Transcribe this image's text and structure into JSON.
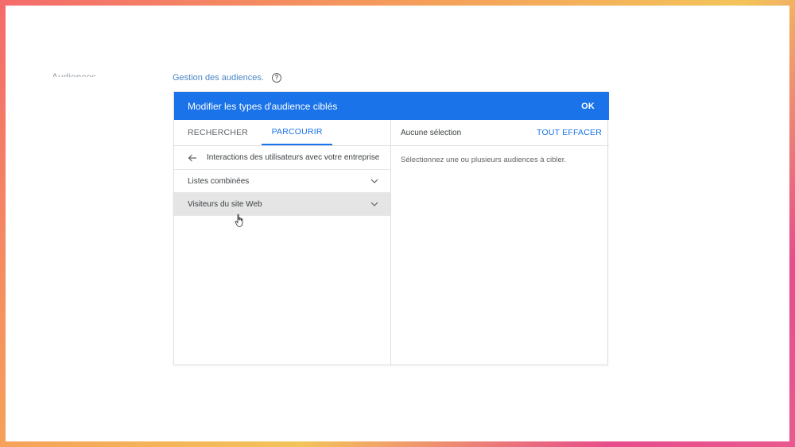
{
  "left_label": "Audiences",
  "page": {
    "link": "Gestion des audiences.",
    "help_icon": "help-circle-icon"
  },
  "dialog": {
    "title": "Modifier les types d'audience ciblés",
    "ok_label": "OK",
    "tabs": [
      {
        "label": "RECHERCHER",
        "active": false
      },
      {
        "label": "PARCOURIR",
        "active": true
      }
    ],
    "back_label": "Interactions des utilisateurs avec votre entreprise",
    "items": [
      {
        "label": "Listes combinées",
        "hovered": false
      },
      {
        "label": "Visiteurs du site Web",
        "hovered": true
      }
    ],
    "right": {
      "no_selection": "Aucune sélection",
      "clear_label": "TOUT EFFACER",
      "hint": "Sélectionnez une ou plusieurs audiences à cibler."
    }
  },
  "colors": {
    "accent": "#1a73e8",
    "link": "#4a86c5",
    "hover_row": "#e5e5e5"
  }
}
